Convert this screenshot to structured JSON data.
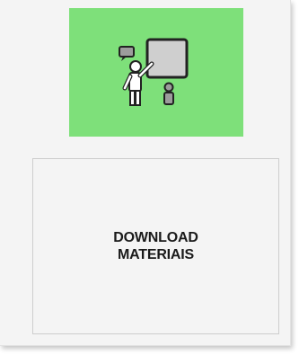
{
  "tile": {
    "icon": "teacher-presentation-icon",
    "background_color": "#7ee07a"
  },
  "download": {
    "line1": "DOWNLOAD",
    "line2": "MATERIAIS"
  }
}
